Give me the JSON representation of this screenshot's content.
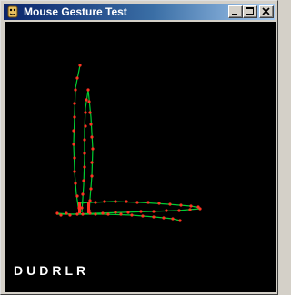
{
  "window": {
    "title": "Mouse Gesture Test",
    "title_gradient_start": "#0a246a",
    "title_gradient_end": "#a6caf0",
    "icon": "app-icon"
  },
  "controls": {
    "minimize_icon": "minimize-icon",
    "maximize_icon": "maximize-icon",
    "close_icon": "close-icon"
  },
  "canvas": {
    "background": "#000000",
    "stroke_line_color": "#00cc33",
    "stroke_point_color": "#ff3322"
  },
  "gesture_result": "DUDRLR"
}
